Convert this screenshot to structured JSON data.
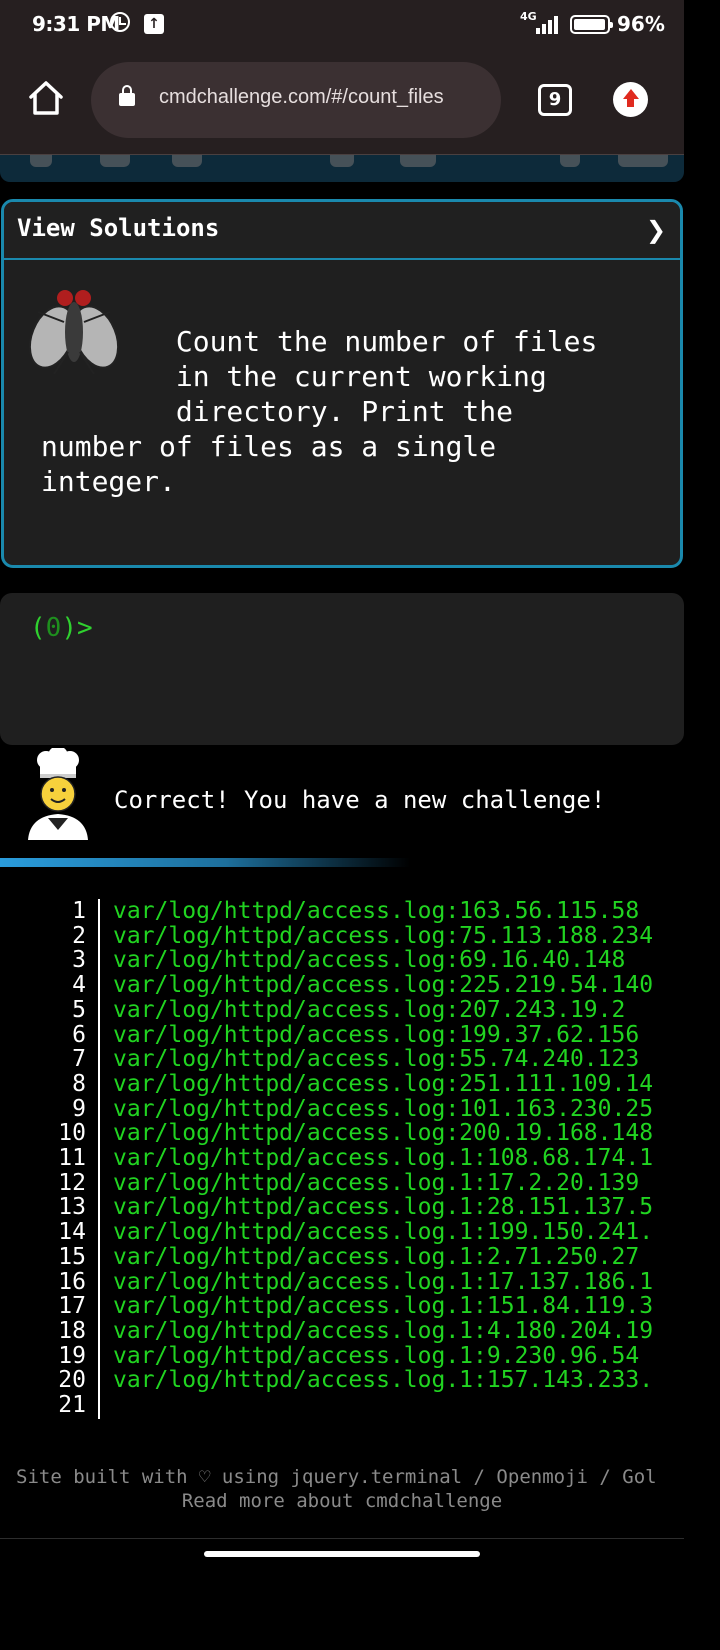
{
  "status_bar": {
    "time": "9:31 PM",
    "network": "4G",
    "battery": "96%",
    "icons": [
      "alarm-icon",
      "upload-icon",
      "signal-icon",
      "battery-icon"
    ]
  },
  "browser": {
    "url": "cmdchallenge.com/#/count_files",
    "tab_count": "9",
    "icons": [
      "home-icon",
      "lock-icon",
      "tabs-icon",
      "update-icon"
    ]
  },
  "challenge": {
    "header": "View Solutions",
    "chevron": "❯",
    "description": "        Count the number of files\n        in the current working\n        directory. Print the\nnumber of files as a single\ninteger."
  },
  "terminal": {
    "prompt_open": "(",
    "prompt_count": "0",
    "prompt_close": ")>"
  },
  "feedback": {
    "message": "Correct! You have a new challenge!"
  },
  "output": {
    "lines": [
      {
        "n": "1",
        "text": "var/log/httpd/access.log:163.56.115.58"
      },
      {
        "n": "2",
        "text": "var/log/httpd/access.log:75.113.188.234"
      },
      {
        "n": "3",
        "text": "var/log/httpd/access.log:69.16.40.148"
      },
      {
        "n": "4",
        "text": "var/log/httpd/access.log:225.219.54.140"
      },
      {
        "n": "5",
        "text": "var/log/httpd/access.log:207.243.19.2"
      },
      {
        "n": "6",
        "text": "var/log/httpd/access.log:199.37.62.156"
      },
      {
        "n": "7",
        "text": "var/log/httpd/access.log:55.74.240.123"
      },
      {
        "n": "8",
        "text": "var/log/httpd/access.log:251.111.109.14"
      },
      {
        "n": "9",
        "text": "var/log/httpd/access.log:101.163.230.25"
      },
      {
        "n": "10",
        "text": "var/log/httpd/access.log:200.19.168.148"
      },
      {
        "n": "11",
        "text": "var/log/httpd/access.log.1:108.68.174.1"
      },
      {
        "n": "12",
        "text": "var/log/httpd/access.log.1:17.2.20.139"
      },
      {
        "n": "13",
        "text": "var/log/httpd/access.log.1:28.151.137.5"
      },
      {
        "n": "14",
        "text": "var/log/httpd/access.log.1:199.150.241."
      },
      {
        "n": "15",
        "text": "var/log/httpd/access.log.1:2.71.250.27"
      },
      {
        "n": "16",
        "text": "var/log/httpd/access.log.1:17.137.186.1"
      },
      {
        "n": "17",
        "text": "var/log/httpd/access.log.1:151.84.119.3"
      },
      {
        "n": "18",
        "text": "var/log/httpd/access.log.1:4.180.204.19"
      },
      {
        "n": "19",
        "text": "var/log/httpd/access.log.1:9.230.96.54"
      },
      {
        "n": "20",
        "text": "var/log/httpd/access.log.1:157.143.233."
      },
      {
        "n": "21",
        "text": ""
      }
    ]
  },
  "footer": {
    "credits": "Site built with ♡ using jquery.terminal / Openmoji / Gol",
    "link": "Read more about cmdchallenge"
  },
  "colors": {
    "accent": "#1a89ad",
    "terminal_green": "#21d421",
    "chrome": "#261f20",
    "card_bg": "#1f1f1f"
  }
}
